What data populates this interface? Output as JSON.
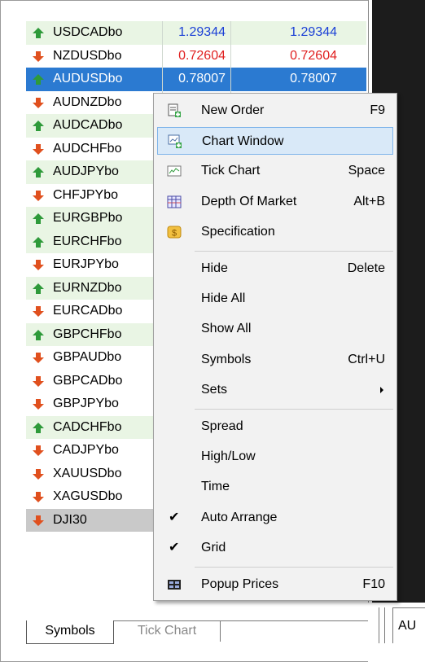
{
  "symbols": [
    {
      "name": "USDCADbo",
      "dir": "up",
      "bid": "1.29344",
      "ask": "1.29344",
      "bg": "green"
    },
    {
      "name": "NZDUSDbo",
      "dir": "down",
      "bid": "0.72604",
      "ask": "0.72604",
      "bg": "white"
    },
    {
      "name": "AUDUSDbo",
      "dir": "up",
      "bid": "0.78007",
      "ask": "0.78007",
      "bg": "selected"
    },
    {
      "name": "AUDNZDbo",
      "dir": "down",
      "bid": "",
      "ask": "",
      "bg": "white"
    },
    {
      "name": "AUDCADbo",
      "dir": "up",
      "bid": "",
      "ask": "",
      "bg": "green"
    },
    {
      "name": "AUDCHFbo",
      "dir": "down",
      "bid": "",
      "ask": "",
      "bg": "white"
    },
    {
      "name": "AUDJPYbo",
      "dir": "up",
      "bid": "",
      "ask": "",
      "bg": "green"
    },
    {
      "name": "CHFJPYbo",
      "dir": "down",
      "bid": "",
      "ask": "",
      "bg": "white"
    },
    {
      "name": "EURGBPbo",
      "dir": "up",
      "bid": "",
      "ask": "",
      "bg": "green"
    },
    {
      "name": "EURCHFbo",
      "dir": "up",
      "bid": "",
      "ask": "",
      "bg": "green"
    },
    {
      "name": "EURJPYbo",
      "dir": "down",
      "bid": "",
      "ask": "",
      "bg": "white"
    },
    {
      "name": "EURNZDbo",
      "dir": "up",
      "bid": "",
      "ask": "",
      "bg": "green"
    },
    {
      "name": "EURCADbo",
      "dir": "down",
      "bid": "",
      "ask": "",
      "bg": "white"
    },
    {
      "name": "GBPCHFbo",
      "dir": "up",
      "bid": "",
      "ask": "",
      "bg": "green"
    },
    {
      "name": "GBPAUDbo",
      "dir": "down",
      "bid": "",
      "ask": "",
      "bg": "white"
    },
    {
      "name": "GBPCADbo",
      "dir": "down",
      "bid": "",
      "ask": "",
      "bg": "white"
    },
    {
      "name": "GBPJPYbo",
      "dir": "down",
      "bid": "",
      "ask": "",
      "bg": "white"
    },
    {
      "name": "CADCHFbo",
      "dir": "up",
      "bid": "",
      "ask": "",
      "bg": "green"
    },
    {
      "name": "CADJPYbo",
      "dir": "down",
      "bid": "",
      "ask": "",
      "bg": "white"
    },
    {
      "name": "XAUUSDbo",
      "dir": "down",
      "bid": "",
      "ask": "",
      "bg": "white"
    },
    {
      "name": "XAGUSDbo",
      "dir": "down",
      "bid": "",
      "ask": "",
      "bg": "white"
    },
    {
      "name": "DJI30",
      "dir": "down",
      "bid": "",
      "ask": "",
      "bg": "gray"
    }
  ],
  "tabs": {
    "symbols": "Symbols",
    "tick_chart": "Tick Chart"
  },
  "right_tab": "AU",
  "menu": [
    {
      "label": "New Order",
      "shortcut": "F9",
      "icon": "new-order-icon"
    },
    {
      "label": "Chart Window",
      "shortcut": "",
      "icon": "chart-window-icon",
      "highlight": true
    },
    {
      "label": "Tick Chart",
      "shortcut": "Space",
      "icon": "tick-chart-icon"
    },
    {
      "label": "Depth Of Market",
      "shortcut": "Alt+B",
      "icon": "depth-of-market-icon"
    },
    {
      "label": "Specification",
      "shortcut": "",
      "icon": "specification-icon"
    },
    {
      "label": "Hide",
      "shortcut": "Delete",
      "icon": ""
    },
    {
      "label": "Hide All",
      "shortcut": "",
      "icon": ""
    },
    {
      "label": "Show All",
      "shortcut": "",
      "icon": ""
    },
    {
      "label": "Symbols",
      "shortcut": "Ctrl+U",
      "icon": ""
    },
    {
      "label": "Sets",
      "shortcut": "",
      "icon": "",
      "submenu": true
    },
    {
      "label": "Spread",
      "shortcut": "",
      "icon": ""
    },
    {
      "label": "High/Low",
      "shortcut": "",
      "icon": ""
    },
    {
      "label": "Time",
      "shortcut": "",
      "icon": ""
    },
    {
      "label": "Auto Arrange",
      "shortcut": "",
      "icon": "",
      "checked": true
    },
    {
      "label": "Grid",
      "shortcut": "",
      "icon": "",
      "checked": true
    },
    {
      "label": "Popup Prices",
      "shortcut": "F10",
      "icon": "popup-prices-icon"
    }
  ],
  "colors": {
    "up_arrow": "#2e9a3a",
    "down_arrow": "#e0501e",
    "selection": "#2b7ad1",
    "row_green": "#e9f5e4",
    "bid_up": "#1a3fd6",
    "bid_down": "#e02020"
  }
}
